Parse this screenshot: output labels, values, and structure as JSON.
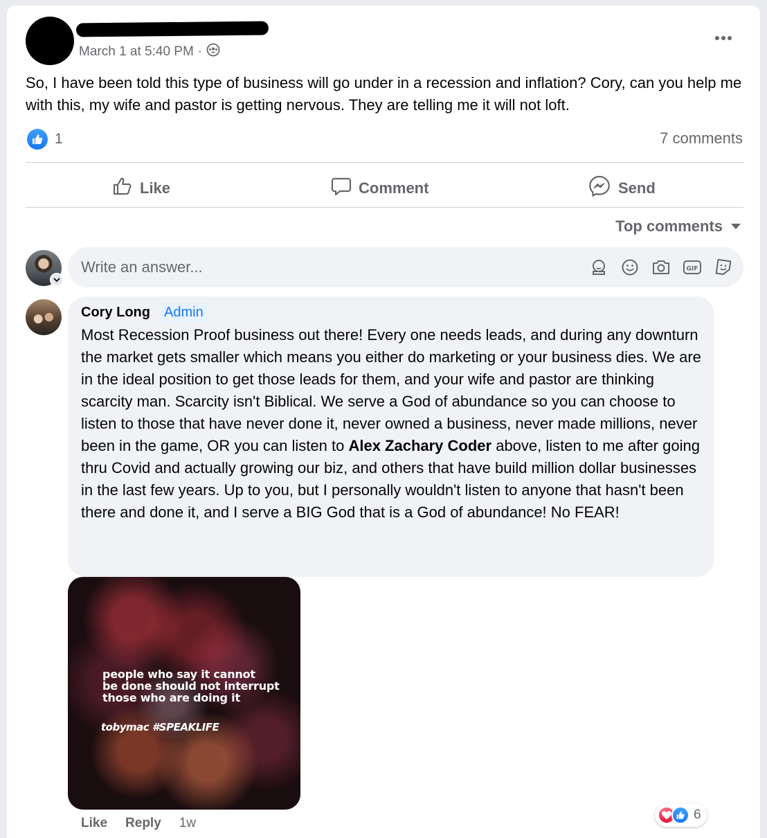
{
  "post": {
    "timestamp": "March 1 at 5:40 PM",
    "separator": "·",
    "privacy_icon": "group-icon",
    "text": "So, I have been told this type of business will go under in a recession and inflation?  Cory, can you help me with this, my wife and pastor is getting nervous. They are telling me it will not loft.",
    "reaction_count": "1",
    "comments_count": "7 comments"
  },
  "actions": {
    "like": "Like",
    "comment": "Comment",
    "send": "Send"
  },
  "sort": {
    "label": "Top comments"
  },
  "composer": {
    "placeholder": "Write an answer..."
  },
  "comment": {
    "author": "Cory Long",
    "badge": "Admin",
    "text_before": "Most Recession Proof business out there! Every one needs leads, and during any downturn the market gets smaller which means you either do marketing or your business dies. We are in the ideal position to get those leads for them, and your wife and pastor are thinking scarcity man. Scarcity isn't Biblical. We serve a God of abundance so you can choose to listen to those that have never done it, never owned a business, never made millions, never been in the game, OR you can listen to ",
    "mention": "Alex Zachary Coder",
    "text_after": " above, listen to me after going thru Covid and actually growing our biz, and others that have build million dollar businesses in the last few years. Up to you, but I personally wouldn't listen to anyone that hasn't been there and done it, and I serve a BIG God that is a God of abundance! No FEAR!",
    "image": {
      "line1": "people who say it cannot",
      "line2": "be done should not interrupt",
      "line3": "those who are doing it",
      "signature": "tobymac #SPEAKLIFE"
    },
    "like_label": "Like",
    "reply_label": "Reply",
    "time": "1w",
    "reaction_count": "6"
  },
  "colors": {
    "accent": "#1877f2",
    "secondary_text": "#65676b",
    "bubble_bg": "#f0f2f5",
    "love": "#e61739"
  }
}
